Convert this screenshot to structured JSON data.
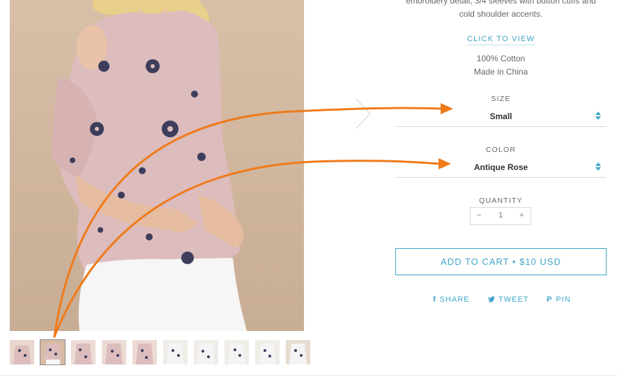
{
  "product": {
    "description_lines": [
      "embroidery detail, 3/4 sleeves with button cuffs and",
      "cold shoulder accents."
    ],
    "click_to_view": "CLICK TO VIEW",
    "material_lines": [
      "100% Cotton",
      "Made in China"
    ]
  },
  "options": {
    "size": {
      "label": "SIZE",
      "value": "Small"
    },
    "color": {
      "label": "COLOR",
      "value": "Antique Rose"
    }
  },
  "quantity": {
    "label": "QUANTITY",
    "minus": "−",
    "value": "1",
    "plus": "+"
  },
  "add_to_cart": "ADD TO CART • $10 USD",
  "share": [
    {
      "icon": "facebook-icon",
      "glyph": "f",
      "label": "SHARE"
    },
    {
      "icon": "twitter-icon",
      "glyph": "🐦",
      "label": "TWEET"
    },
    {
      "icon": "pinterest-icon",
      "glyph": "P",
      "label": "PIN"
    }
  ],
  "colors": {
    "accent": "#3fa5c9",
    "annotation_arrow": "#f07a1a",
    "shirt": "#dcbcbc"
  },
  "thumbnails_count": 10
}
